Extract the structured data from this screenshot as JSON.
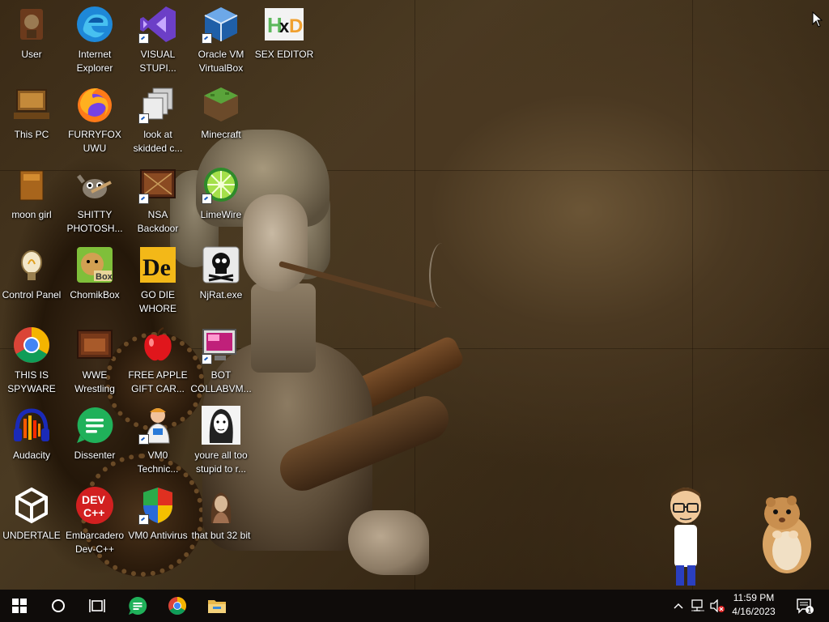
{
  "desktop": {
    "icons": [
      {
        "label": "User",
        "icon": "user-folder-icon"
      },
      {
        "label": "Internet Explorer",
        "icon": "edge-icon"
      },
      {
        "label": "VISUAL STUPI...",
        "icon": "visual-studio-icon"
      },
      {
        "label": "Oracle VM VirtualBox",
        "icon": "virtualbox-icon"
      },
      {
        "label": "SEX EDITOR",
        "icon": "hxd-icon"
      },
      {
        "label": "This PC",
        "icon": "this-pc-icon"
      },
      {
        "label": "FURRYFOX UWU",
        "icon": "firefox-icon"
      },
      {
        "label": "look at skidded c...",
        "icon": "stacked-windows-icon"
      },
      {
        "label": "Minecraft",
        "icon": "minecraft-icon"
      },
      {
        "label": "moon girl",
        "icon": "folder-icon"
      },
      {
        "label": "SHITTY PHOTOSH...",
        "icon": "gimp-icon"
      },
      {
        "label": "NSA Backdoor",
        "icon": "nsa-backdoor-icon"
      },
      {
        "label": "LimeWire",
        "icon": "limewire-icon"
      },
      {
        "label": "Control Panel",
        "icon": "control-panel-icon"
      },
      {
        "label": "ChomikBox",
        "icon": "chomikbox-icon"
      },
      {
        "label": "GO DIE WHORE",
        "icon": "de-icon"
      },
      {
        "label": "NjRat.exe",
        "icon": "skull-icon"
      },
      {
        "label": "THIS IS SPYWARE",
        "icon": "chrome-icon"
      },
      {
        "label": "WWE Wrestling",
        "icon": "wrestling-icon"
      },
      {
        "label": "FREE APPLE GIFT CAR...",
        "icon": "apple-icon"
      },
      {
        "label": "BOT COLLABVM...",
        "icon": "monitor-icon"
      },
      {
        "label": "Audacity",
        "icon": "audacity-icon"
      },
      {
        "label": "Dissenter",
        "icon": "dissenter-icon"
      },
      {
        "label": "VM0 Technic...",
        "icon": "technician-icon"
      },
      {
        "label": "youre all too stupid to r...",
        "icon": "portrait-icon"
      },
      {
        "label": "UNDERTALE",
        "icon": "unity-icon"
      },
      {
        "label": "Embarcadero Dev-C++",
        "icon": "devcpp-icon"
      },
      {
        "label": "VM0 Antivirus",
        "icon": "shield-icon"
      },
      {
        "label": "that but 32 bit",
        "icon": "painting-icon"
      }
    ],
    "devcpp_badge": "DEV C++",
    "chomik_badge": "Box",
    "de_badge": "De",
    "hxd_badge": "HxD"
  },
  "taskbar": {
    "start": "windows-start-icon",
    "search": "search-circle-icon",
    "task_view": "task-view-icon",
    "pinned": [
      "dissenter-icon",
      "chrome-icon",
      "file-explorer-icon"
    ],
    "tray": {
      "chevron": "show-hidden-icons-chevron",
      "network": "network-icon",
      "volume": "volume-muted-icon",
      "notifications_count": "1"
    },
    "time": "11:59 PM",
    "date": "4/16/2023"
  },
  "colors": {
    "taskbar": "#0f0c0a",
    "accent_edge": "#1e88d8",
    "vs_purple": "#6c3fc7",
    "dissenter_green": "#20b15a",
    "devcpp_red": "#d22020"
  }
}
